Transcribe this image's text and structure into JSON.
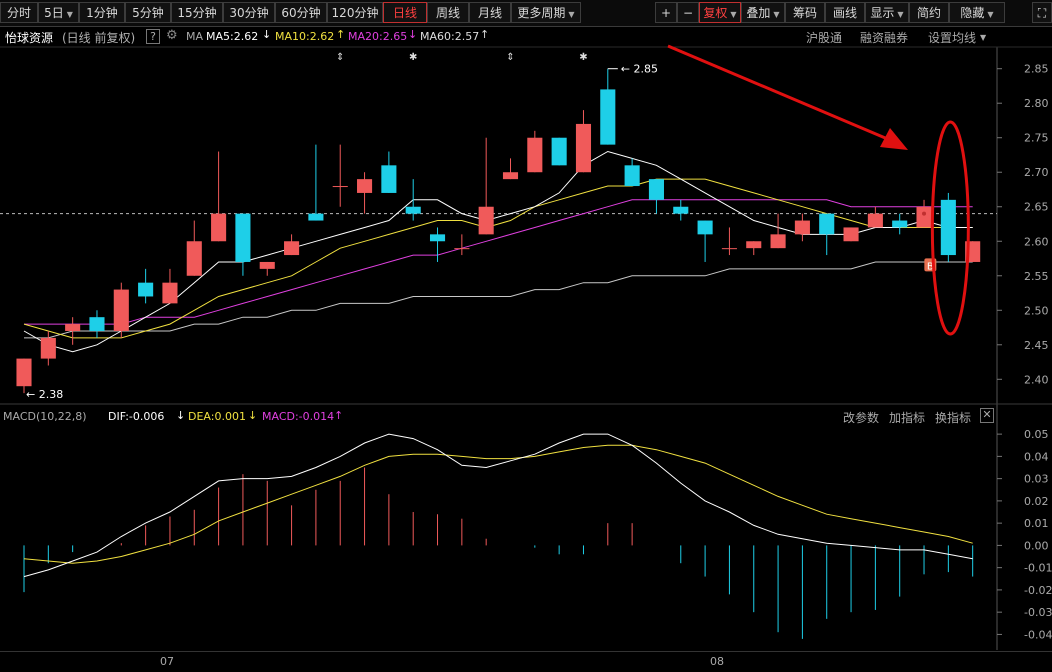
{
  "toolbar": {
    "periods": [
      "分时",
      "5日",
      "1分钟",
      "5分钟",
      "15分钟",
      "30分钟",
      "60分钟",
      "120分钟",
      "日线",
      "周线",
      "月线",
      "更多周期"
    ],
    "active_period": "日线",
    "right_buttons": [
      "+",
      "−",
      "复权",
      "叠加",
      "筹码",
      "画线",
      "显示",
      "简约",
      "隐藏"
    ]
  },
  "stock": {
    "name": "怡球资源",
    "mode": "(日线 前复权)",
    "help": "?",
    "ma_label": "MA",
    "ma5": "MA5:2.62",
    "ma10": "MA10:2.62",
    "ma20": "MA20:2.65",
    "ma60": "MA60:2.57",
    "links": [
      "沪股通",
      "融资融券",
      "设置均线"
    ]
  },
  "macd": {
    "label": "MACD(10,22,8)",
    "dif": "DIF:-0.006",
    "dea": "DEA:0.001",
    "macd": "MACD:-0.014",
    "links": [
      "改参数",
      "加指标",
      "换指标"
    ]
  },
  "bottom_axis": {
    "labels": [
      "07",
      "08"
    ]
  },
  "markers": {
    "b_label": "B"
  },
  "colors": {
    "up": "#f05a5a",
    "down": "#1ecfe8",
    "ma5": "#ffffff",
    "ma10": "#f0e040",
    "ma20": "#e040e0",
    "ma60": "#c8c8c8",
    "arrow": "#e01010"
  },
  "chart_data": [
    {
      "type": "candlestick",
      "title": "怡球资源 日线",
      "price_axis": {
        "ticks": [
          2.4,
          2.45,
          2.5,
          2.55,
          2.6,
          2.65,
          2.7,
          2.75,
          2.8,
          2.85
        ]
      },
      "ylim": [
        2.37,
        2.88
      ],
      "high_label": "2.85",
      "low_label": "2.38",
      "reference_price": 2.64,
      "candles": [
        {
          "o": 2.39,
          "h": 2.43,
          "l": 2.38,
          "c": 2.43
        },
        {
          "o": 2.43,
          "h": 2.47,
          "l": 2.42,
          "c": 2.46
        },
        {
          "o": 2.47,
          "h": 2.49,
          "l": 2.45,
          "c": 2.48
        },
        {
          "o": 2.49,
          "h": 2.5,
          "l": 2.46,
          "c": 2.47
        },
        {
          "o": 2.47,
          "h": 2.54,
          "l": 2.46,
          "c": 2.53
        },
        {
          "o": 2.54,
          "h": 2.56,
          "l": 2.51,
          "c": 2.52
        },
        {
          "o": 2.51,
          "h": 2.56,
          "l": 2.51,
          "c": 2.54
        },
        {
          "o": 2.55,
          "h": 2.63,
          "l": 2.55,
          "c": 2.6
        },
        {
          "o": 2.6,
          "h": 2.73,
          "l": 2.6,
          "c": 2.64
        },
        {
          "o": 2.64,
          "h": 2.64,
          "l": 2.55,
          "c": 2.57
        },
        {
          "o": 2.56,
          "h": 2.57,
          "l": 2.55,
          "c": 2.57
        },
        {
          "o": 2.58,
          "h": 2.61,
          "l": 2.58,
          "c": 2.6
        },
        {
          "o": 2.64,
          "h": 2.74,
          "l": 2.63,
          "c": 2.63
        },
        {
          "o": 2.68,
          "h": 2.74,
          "l": 2.65,
          "c": 2.68
        },
        {
          "o": 2.67,
          "h": 2.7,
          "l": 2.64,
          "c": 2.69
        },
        {
          "o": 2.71,
          "h": 2.73,
          "l": 2.67,
          "c": 2.67
        },
        {
          "o": 2.65,
          "h": 2.69,
          "l": 2.63,
          "c": 2.64
        },
        {
          "o": 2.61,
          "h": 2.62,
          "l": 2.57,
          "c": 2.6
        },
        {
          "o": 2.59,
          "h": 2.61,
          "l": 2.58,
          "c": 2.59
        },
        {
          "o": 2.61,
          "h": 2.75,
          "l": 2.61,
          "c": 2.65
        },
        {
          "o": 2.69,
          "h": 2.72,
          "l": 2.69,
          "c": 2.7
        },
        {
          "o": 2.7,
          "h": 2.76,
          "l": 2.7,
          "c": 2.75
        },
        {
          "o": 2.75,
          "h": 2.75,
          "l": 2.71,
          "c": 2.71
        },
        {
          "o": 2.7,
          "h": 2.79,
          "l": 2.7,
          "c": 2.77
        },
        {
          "o": 2.82,
          "h": 2.85,
          "l": 2.74,
          "c": 2.74
        },
        {
          "o": 2.71,
          "h": 2.72,
          "l": 2.68,
          "c": 2.68
        },
        {
          "o": 2.69,
          "h": 2.69,
          "l": 2.64,
          "c": 2.66
        },
        {
          "o": 2.65,
          "h": 2.66,
          "l": 2.63,
          "c": 2.64
        },
        {
          "o": 2.63,
          "h": 2.63,
          "l": 2.57,
          "c": 2.61
        },
        {
          "o": 2.59,
          "h": 2.62,
          "l": 2.58,
          "c": 2.59
        },
        {
          "o": 2.59,
          "h": 2.6,
          "l": 2.58,
          "c": 2.6
        },
        {
          "o": 2.59,
          "h": 2.64,
          "l": 2.59,
          "c": 2.61
        },
        {
          "o": 2.61,
          "h": 2.64,
          "l": 2.6,
          "c": 2.63
        },
        {
          "o": 2.64,
          "h": 2.64,
          "l": 2.58,
          "c": 2.61
        },
        {
          "o": 2.6,
          "h": 2.62,
          "l": 2.6,
          "c": 2.62
        },
        {
          "o": 2.62,
          "h": 2.65,
          "l": 2.62,
          "c": 2.64
        },
        {
          "o": 2.63,
          "h": 2.64,
          "l": 2.61,
          "c": 2.62
        },
        {
          "o": 2.62,
          "h": 2.66,
          "l": 2.62,
          "c": 2.65
        },
        {
          "o": 2.66,
          "h": 2.67,
          "l": 2.57,
          "c": 2.58
        },
        {
          "o": 2.57,
          "h": 2.6,
          "l": 2.57,
          "c": 2.6
        }
      ],
      "ma5": [
        2.47,
        2.45,
        2.44,
        2.45,
        2.47,
        2.49,
        2.51,
        2.54,
        2.57,
        2.57,
        2.58,
        2.59,
        2.6,
        2.61,
        2.62,
        2.63,
        2.66,
        2.66,
        2.64,
        2.63,
        2.64,
        2.65,
        2.67,
        2.71,
        2.73,
        2.72,
        2.71,
        2.69,
        2.67,
        2.65,
        2.63,
        2.62,
        2.61,
        2.61,
        2.61,
        2.62,
        2.62,
        2.63,
        2.62,
        2.62
      ],
      "ma10": [
        2.48,
        2.47,
        2.46,
        2.46,
        2.46,
        2.47,
        2.48,
        2.5,
        2.52,
        2.53,
        2.54,
        2.55,
        2.57,
        2.59,
        2.6,
        2.61,
        2.62,
        2.63,
        2.63,
        2.62,
        2.63,
        2.65,
        2.66,
        2.67,
        2.68,
        2.68,
        2.69,
        2.69,
        2.69,
        2.68,
        2.67,
        2.66,
        2.65,
        2.64,
        2.63,
        2.62,
        2.62,
        2.62,
        2.62,
        2.62
      ],
      "ma20": [
        2.48,
        2.48,
        2.48,
        2.48,
        2.48,
        2.49,
        2.49,
        2.49,
        2.5,
        2.51,
        2.52,
        2.53,
        2.54,
        2.55,
        2.56,
        2.57,
        2.58,
        2.58,
        2.59,
        2.6,
        2.61,
        2.62,
        2.63,
        2.64,
        2.65,
        2.66,
        2.66,
        2.66,
        2.66,
        2.66,
        2.66,
        2.66,
        2.66,
        2.66,
        2.65,
        2.65,
        2.65,
        2.65,
        2.65,
        2.65
      ],
      "ma60": [
        2.46,
        2.46,
        2.47,
        2.47,
        2.47,
        2.47,
        2.47,
        2.48,
        2.48,
        2.49,
        2.49,
        2.5,
        2.5,
        2.51,
        2.51,
        2.51,
        2.52,
        2.52,
        2.52,
        2.52,
        2.52,
        2.53,
        2.53,
        2.54,
        2.54,
        2.55,
        2.55,
        2.55,
        2.55,
        2.56,
        2.56,
        2.56,
        2.56,
        2.56,
        2.56,
        2.57,
        2.57,
        2.57,
        2.57,
        2.57
      ]
    },
    {
      "type": "macd",
      "title": "MACD(10,22,8)",
      "axis": {
        "ticks": [
          0.05,
          0.04,
          0.03,
          0.02,
          0.01,
          0.0,
          -0.01,
          -0.02,
          -0.03,
          -0.04
        ]
      },
      "ylim": [
        -0.047,
        0.055
      ],
      "macd_hist": [
        -0.021,
        -0.008,
        -0.003,
        0.0,
        0.001,
        0.009,
        0.013,
        0.016,
        0.026,
        0.032,
        0.029,
        0.018,
        0.025,
        0.029,
        0.035,
        0.023,
        0.015,
        0.014,
        0.012,
        0.003,
        0.0,
        -0.001,
        -0.004,
        -0.004,
        0.01,
        0.01,
        0.0,
        -0.008,
        -0.014,
        -0.022,
        -0.03,
        -0.039,
        -0.042,
        -0.033,
        -0.03,
        -0.029,
        -0.023,
        -0.013,
        -0.012,
        -0.014
      ],
      "dif": [
        -0.014,
        -0.011,
        -0.007,
        -0.003,
        0.004,
        0.01,
        0.015,
        0.022,
        0.029,
        0.03,
        0.03,
        0.031,
        0.035,
        0.04,
        0.046,
        0.05,
        0.048,
        0.043,
        0.036,
        0.035,
        0.038,
        0.041,
        0.046,
        0.05,
        0.05,
        0.045,
        0.037,
        0.028,
        0.02,
        0.015,
        0.009,
        0.005,
        0.003,
        0.001,
        0.0,
        -0.001,
        -0.002,
        -0.002,
        -0.004,
        -0.006
      ],
      "dea": [
        -0.006,
        -0.007,
        -0.008,
        -0.007,
        -0.005,
        -0.002,
        0.001,
        0.005,
        0.011,
        0.015,
        0.019,
        0.023,
        0.027,
        0.031,
        0.036,
        0.04,
        0.041,
        0.041,
        0.04,
        0.039,
        0.039,
        0.04,
        0.042,
        0.044,
        0.045,
        0.045,
        0.043,
        0.04,
        0.037,
        0.032,
        0.027,
        0.022,
        0.018,
        0.014,
        0.012,
        0.01,
        0.008,
        0.006,
        0.004,
        0.001
      ]
    }
  ]
}
